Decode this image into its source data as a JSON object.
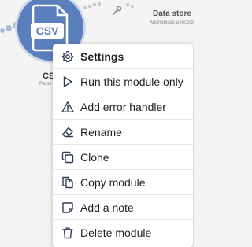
{
  "canvas": {
    "csv_module": {
      "icon": "csv-file-icon",
      "badge": "CSV",
      "label": "CS",
      "sublabel": "Parse"
    },
    "datastore_module": {
      "label": "Data store",
      "sublabel": "Add/replace a record"
    },
    "route_tool": {
      "icon": "wrench-icon"
    }
  },
  "menu": {
    "items": [
      {
        "label": "Settings",
        "icon": "gear-icon"
      },
      {
        "label": "Run this module only",
        "icon": "play-icon"
      },
      {
        "label": "Add error handler",
        "icon": "warning-icon"
      },
      {
        "label": "Rename",
        "icon": "eraser-icon"
      },
      {
        "label": "Clone",
        "icon": "clone-icon"
      },
      {
        "label": "Copy module",
        "icon": "copy-icon"
      },
      {
        "label": "Add a note",
        "icon": "note-icon"
      },
      {
        "label": "Delete module",
        "icon": "trash-icon"
      }
    ]
  },
  "colors": {
    "accent": "#5b7fbd",
    "icon": "#2f3b55",
    "background": "#f4f4f4"
  }
}
